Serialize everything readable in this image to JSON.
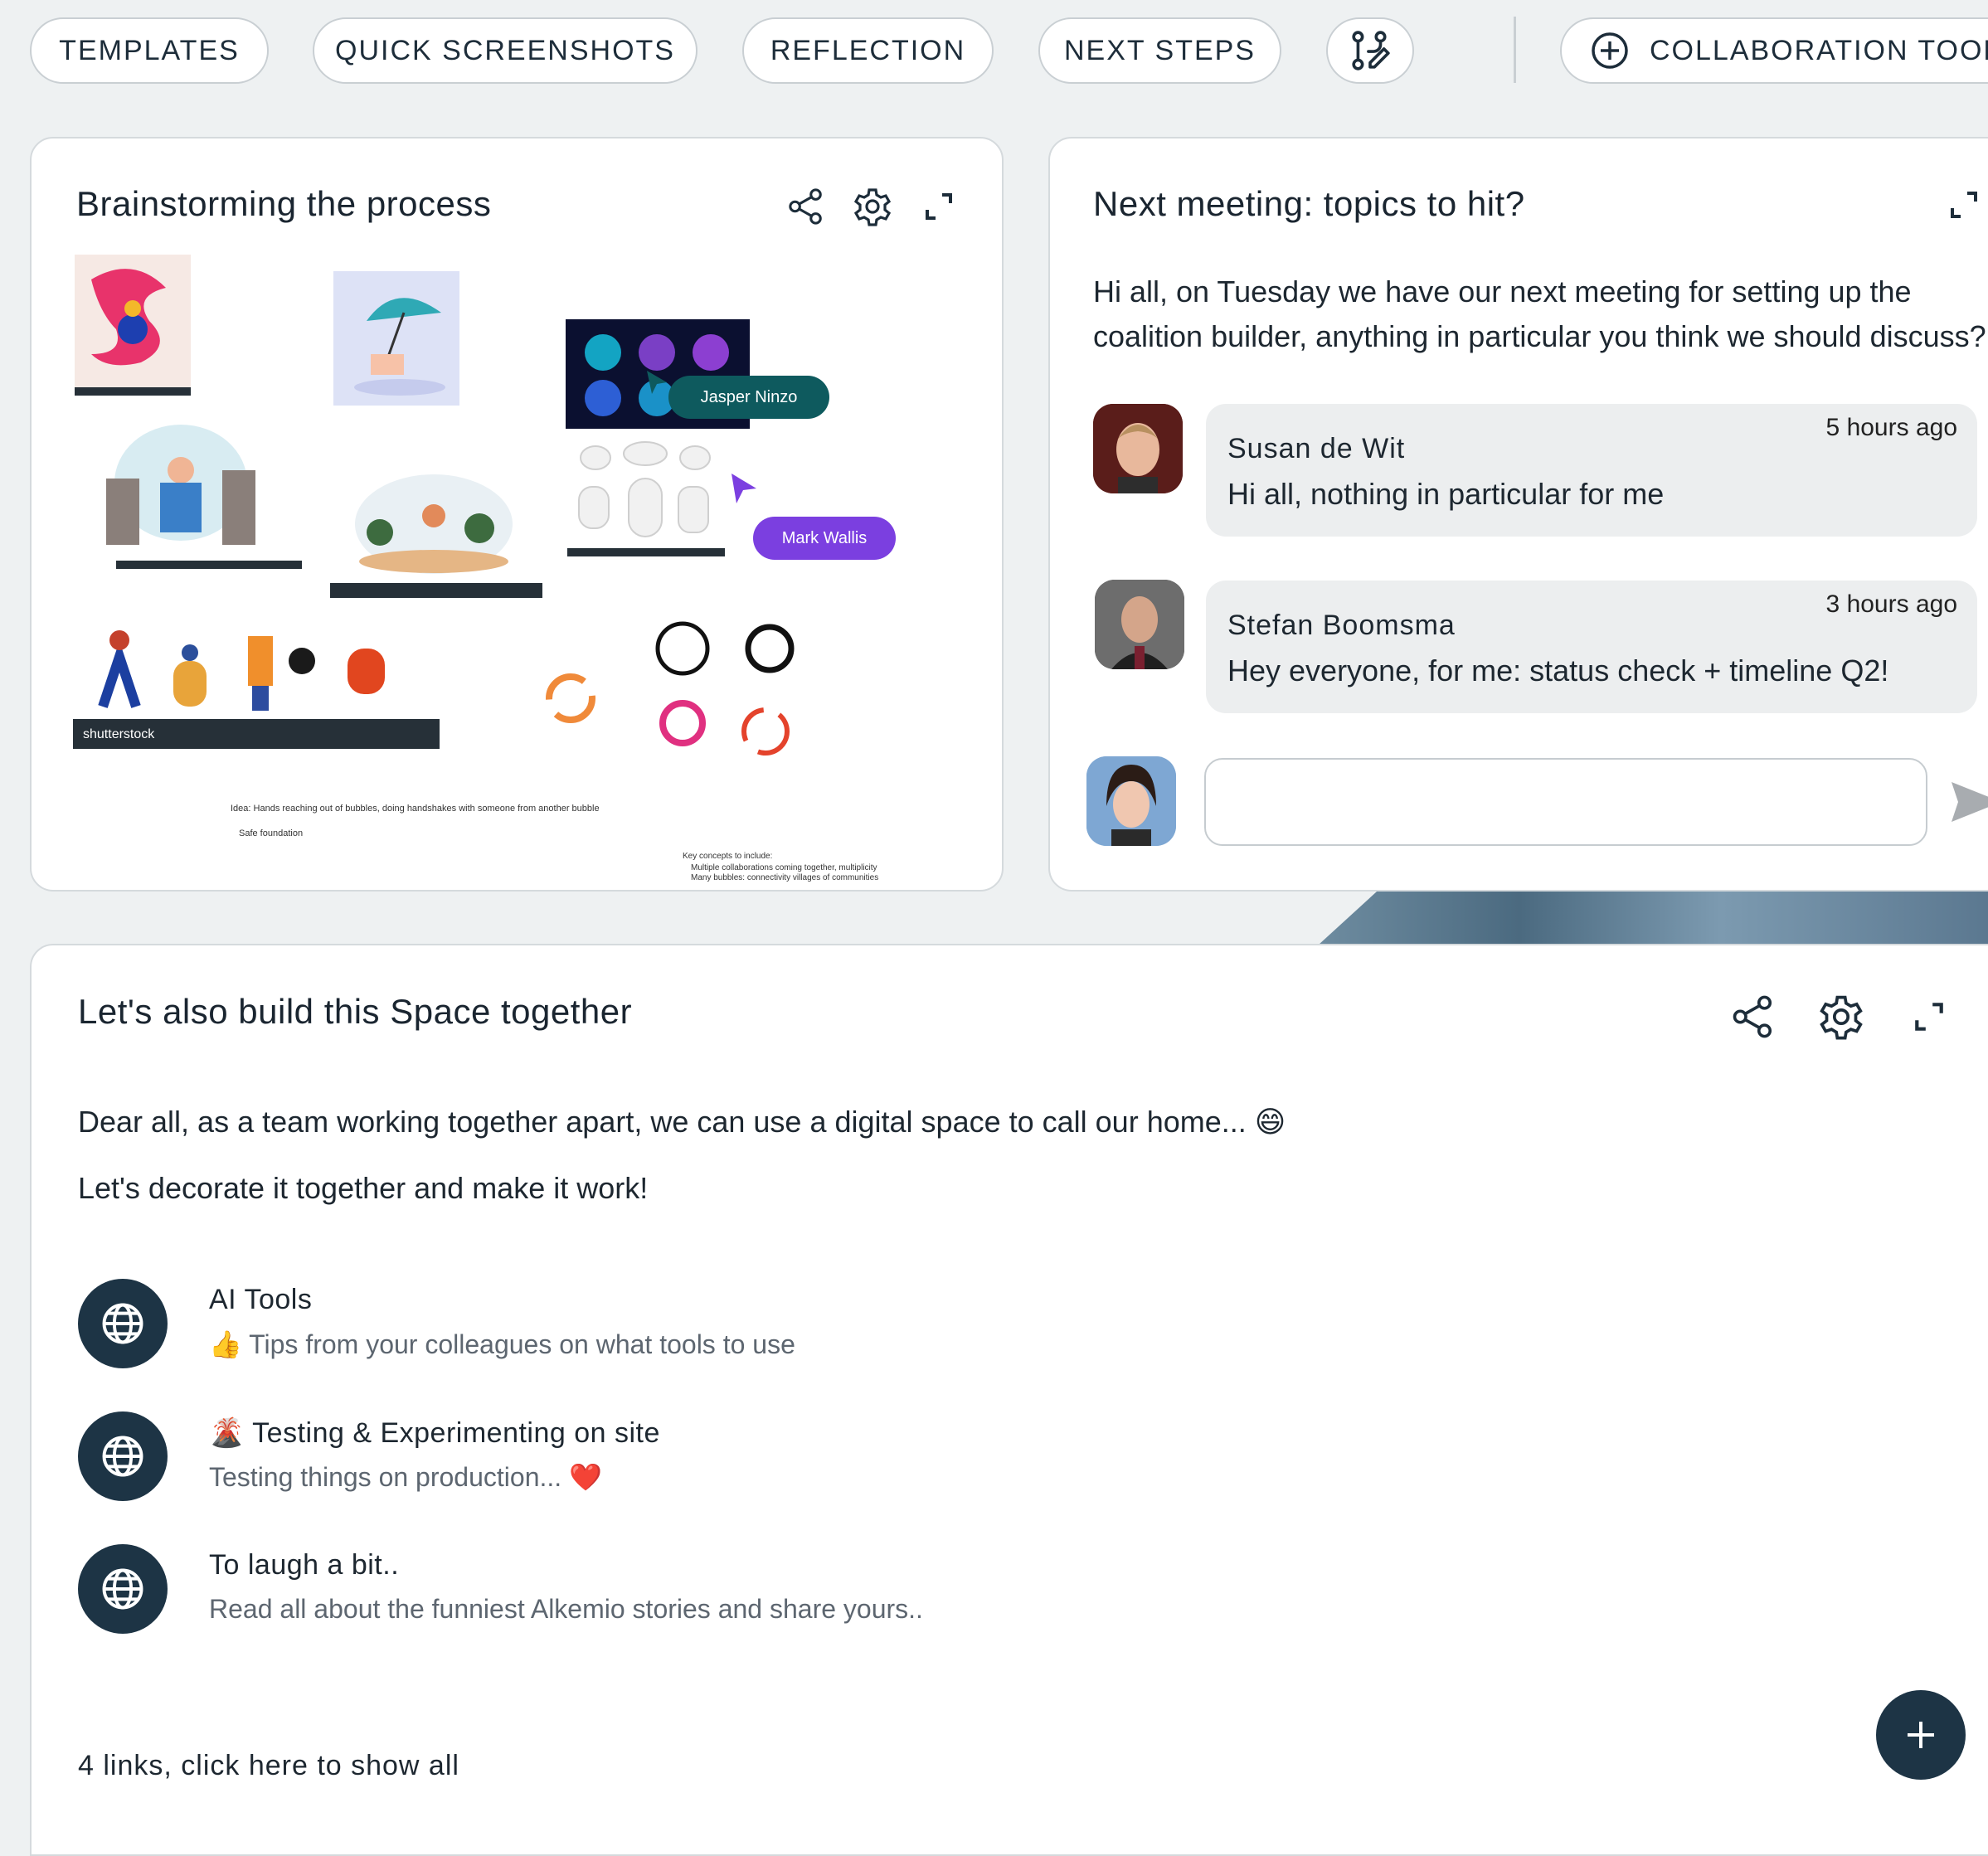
{
  "toolbar": {
    "tabs": [
      "TEMPLATES",
      "QUICK SCREENSHOTS",
      "REFLECTION",
      "NEXT STEPS"
    ],
    "collab_label": "COLLABORATION TOOL"
  },
  "whiteboard_card": {
    "title": "Brainstorming the process",
    "cursors": [
      {
        "name": "Jasper Ninzo",
        "color": "#0e5a5e"
      },
      {
        "name": "Mark Wallis",
        "color": "#7b3fe0"
      }
    ],
    "notes": [
      "Idea: Hands reaching out of bubbles, doing handshakes with someone from another bubble",
      "Safe foundation",
      "Key concepts to include:",
      "Multiple collaborations coming together, multiplicity",
      "Many bubbles: connectivity villages of communities"
    ],
    "image_caption": "shutterstock"
  },
  "meeting_card": {
    "title": "Next meeting: topics to hit?",
    "description": "Hi all, on Tuesday we have our next meeting for setting up the coalition builder, anything in particular you think we should discuss?",
    "messages": [
      {
        "author": "Susan de Wit",
        "time": "5 hours ago",
        "text": "Hi all, nothing in particular for me"
      },
      {
        "author": "Stefan Boomsma",
        "time": "3 hours ago",
        "text": "Hey everyone, for me: status check + timeline Q2!"
      }
    ],
    "reply_placeholder": ""
  },
  "space_card": {
    "title": "Let's also build this Space together",
    "line1": "Dear all, as a team working together apart, we can use a digital space to call our home... 😄",
    "line2": "Let's decorate it together and make it work!",
    "links": [
      {
        "title": "AI Tools",
        "desc": "👍 Tips from your colleagues on what tools to use"
      },
      {
        "title": "🌋 Testing & Experimenting on site",
        "desc": "Testing things on production... ❤️"
      },
      {
        "title": "To laugh a bit..",
        "desc": "Read all about the funniest Alkemio stories and share yours.."
      }
    ],
    "footer": "4 links, click here to show all"
  },
  "colors": {
    "primary": "#1d3445",
    "accent_teal": "#0e5a5e",
    "accent_purple": "#7b3fe0"
  }
}
